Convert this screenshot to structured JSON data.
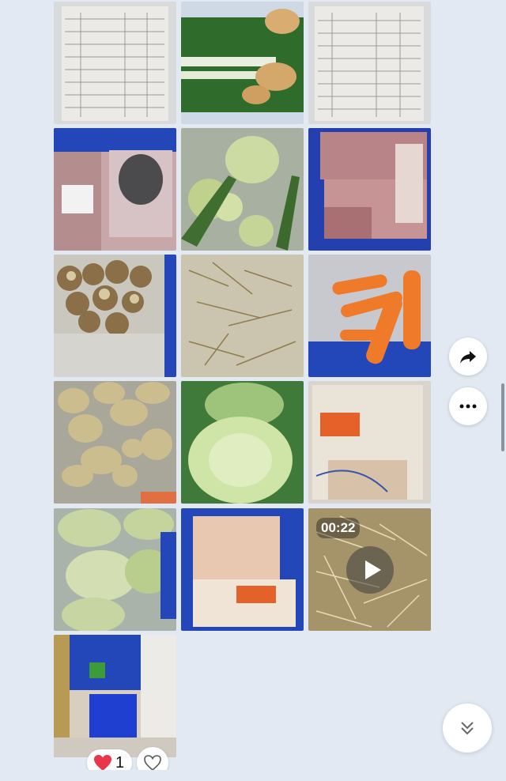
{
  "gallery": {
    "photos": [
      {
        "name": "invoice-document"
      },
      {
        "name": "scallions-and-ginger"
      },
      {
        "name": "invoice-document-2"
      },
      {
        "name": "packaged-meat-label"
      },
      {
        "name": "kohlrabi-bag"
      },
      {
        "name": "pork-cuts-tray"
      },
      {
        "name": "mushrooms-bag"
      },
      {
        "name": "bean-sprouts"
      },
      {
        "name": "carrots-bag"
      },
      {
        "name": "potatoes-bag"
      },
      {
        "name": "cabbage"
      },
      {
        "name": "packaged-chicken"
      },
      {
        "name": "bagged-cabbages"
      },
      {
        "name": "chicken-pieces-crate"
      },
      {
        "name": "bean-sprouts-video"
      },
      {
        "name": "storage-room-crates"
      }
    ],
    "video": {
      "duration": "00:22"
    }
  },
  "reactions": {
    "heart_count": "1"
  },
  "icons": {
    "share": "share-arrow-icon",
    "more": "more-dots-icon",
    "scroll_down": "double-chevron-down-icon",
    "heart": "heart-filled-icon",
    "like": "heart-outline-icon"
  },
  "colors": {
    "background": "#e2e9f2",
    "heart": "#e8364b"
  }
}
